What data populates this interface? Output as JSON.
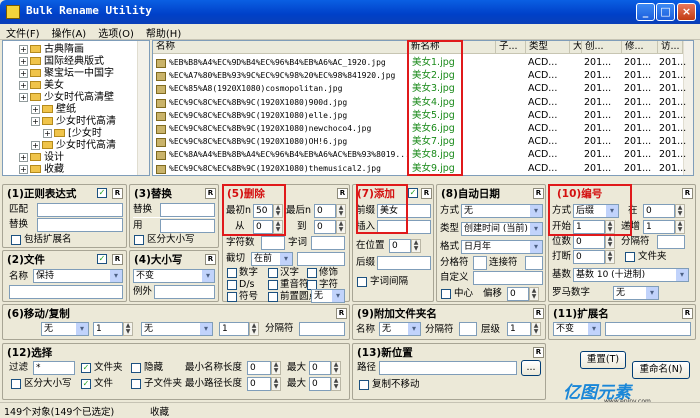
{
  "window": {
    "title": "Bulk Rename Utility"
  },
  "menu": [
    "文件(F)",
    "操作(A)",
    "选项(O)",
    "帮助(H)"
  ],
  "tree": [
    {
      "label": "古典隋画",
      "indent": 1
    },
    {
      "label": "国际经典版式",
      "indent": 1
    },
    {
      "label": "聚宝坛一中国字",
      "indent": 1
    },
    {
      "label": "美女",
      "indent": 1
    },
    {
      "label": "少女时代高清壁",
      "indent": 1
    },
    {
      "label": "壁纸",
      "indent": 2
    },
    {
      "label": "少女时代高清",
      "indent": 2
    },
    {
      "label": "[少女时",
      "indent": 3
    },
    {
      "label": "少女时代高清",
      "indent": 2
    },
    {
      "label": "设计",
      "indent": 1
    },
    {
      "label": "收藏",
      "indent": 1
    }
  ],
  "list": {
    "headers": [
      "名称",
      "新名称",
      "子...",
      "类型",
      "大",
      "创...",
      "修...",
      "访..."
    ],
    "rows": [
      {
        "name": "%EB%B8%A4%EC%9D%B4%EC%96%B4%EB%A6%AC_1920.jpg",
        "new": "美女1.jpg"
      },
      {
        "name": "%EC%A7%80%EB%93%9C%EC%9C%98%20%EC%98%841920.jpg",
        "new": "美女2.jpg"
      },
      {
        "name": "%EC%85%A8(1920X1080)cosmopolitan.jpg",
        "new": "美女3.jpg"
      },
      {
        "name": "%EC%9C%8C%EC%8B%9C(1920X1080)900d.jpg",
        "new": "美女4.jpg"
      },
      {
        "name": "%EC%9C%8C%EC%8B%9C(1920X1080)elle.jpg",
        "new": "美女5.jpg"
      },
      {
        "name": "%EC%9C%8C%EC%8B%9C(1920X1080)newchoco4.jpg",
        "new": "美女6.jpg"
      },
      {
        "name": "%EC%9C%8C%EC%8B%9C(1920X1080)OH!6.jpg",
        "new": "美女7.jpg"
      },
      {
        "name": "%EC%8A%A4%EB%8B%A4%EC%96%B4%EB%A6%AC%EB%93%8019...",
        "new": "美女8.jpg"
      },
      {
        "name": "%EC%9C%8C%EC%8B%9C(1920X1080)themusical2.jpg",
        "new": "美女9.jpg"
      }
    ],
    "type": "ACD...",
    "date": "201..."
  },
  "p1": {
    "title": "(1)正则表达式",
    "match": "匹配",
    "replace": "替换",
    "ext": "包括扩展名"
  },
  "p3": {
    "title": "(3)替换",
    "replace": "替换",
    "with": "用",
    "case": "区分大小写"
  },
  "p5": {
    "title": "(5)删除",
    "first_n_label": "最初n",
    "first_n": "50",
    "last_n_label": "最后n",
    "last_n": "0",
    "from_label": "从",
    "from": "0",
    "to_label": "到",
    "to": "0",
    "chars_label": "字符数",
    "words_label": "字词",
    "crop_label": "截切",
    "crop": "在前",
    "digits": "数字",
    "high": "汉字",
    "trim": "修饰",
    "ds": "D/s",
    "accents": "重音符",
    "chars": "字符",
    "sym": "符号",
    "lead": "前置圆点",
    "none": "无"
  },
  "p7": {
    "title": "(7)添加",
    "prefix_label": "前缀",
    "prefix": "美女",
    "insert_label": "插入",
    "at_label": "在位置",
    "at": "0",
    "suffix_label": "后缀",
    "sep": "字词间隔"
  },
  "p8": {
    "title": "(8)自动日期",
    "mode_label": "方式",
    "mode": "无",
    "type_label": "类型",
    "type": "创建时间 (当前)",
    "fmt_label": "格式",
    "fmt": "日月年",
    "sep_label": "分格符",
    "seg_label": "连接符",
    "custom_label": "自定义",
    "center": "中心",
    "offset_label": "偏移",
    "offset": "0"
  },
  "p10": {
    "title": "(10)编号",
    "mode_label": "方式",
    "mode": "后缀",
    "at_label": "在",
    "at": "0",
    "start_label": "开始",
    "start": "1",
    "incr_label": "递增",
    "incr": "1",
    "pad_label": "位数",
    "pad": "0",
    "sep_label": "分隔符",
    "break_label": "打断",
    "break": "0",
    "folder": "文件夹",
    "base_label": "基数",
    "base": "基数 10 (十进制)",
    "roman_label": "罗马数字",
    "roman": "无"
  },
  "p2": {
    "title": "(2)文件",
    "name_label": "名称",
    "name": "保持"
  },
  "p4": {
    "title": "(4)大小写",
    "case": "不变",
    "except_label": "例外"
  },
  "p6": {
    "title": "(6)移动/复制",
    "a": "无",
    "b": "1",
    "c": "无",
    "d": "1",
    "sep_label": "分隔符"
  },
  "p9": {
    "title": "(9)附加文件夹名",
    "name_label": "名称",
    "name": "无",
    "sep_label": "分隔符",
    "level_label": "层级",
    "level": "1"
  },
  "p11": {
    "title": "(11)扩展名",
    "value": "不变"
  },
  "p12": {
    "title": "(12)选择",
    "filter_label": "过滤",
    "filter": "*",
    "folders": "文件夹",
    "hidden": "隐藏",
    "minname_label": "最小名称长度",
    "minname": "0",
    "max_label": "最大",
    "max1": "0",
    "case": "区分大小写",
    "files": "文件",
    "subfolders": "子文件夹",
    "minpath_label": "最小路径长度",
    "minpath": "0",
    "max2": "0"
  },
  "p13": {
    "title": "(13)新位置",
    "path_label": "路径",
    "copy": "复制不移动",
    "browse": "..."
  },
  "buttons": {
    "reset": "重置(T)",
    "rename": "重命名(N)"
  },
  "status": {
    "count": "149个对象(149个已选定)",
    "folder": "收藏"
  },
  "watermark": {
    "brand": "亿图元素",
    "site": "www.epinv.com"
  }
}
